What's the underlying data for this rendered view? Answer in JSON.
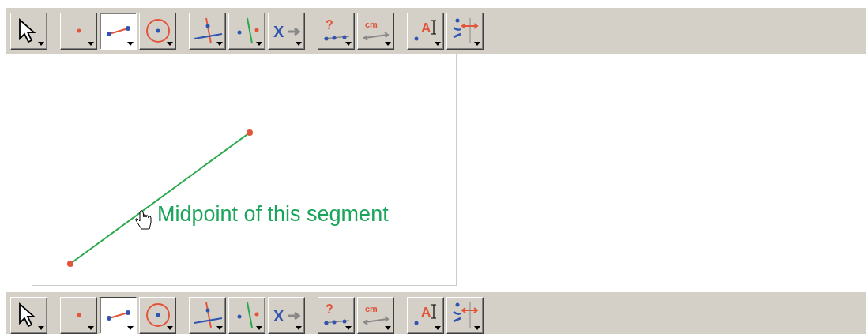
{
  "toolbars": [
    {
      "groups": [
        [
          {
            "kind": "select",
            "selected": false
          }
        ],
        [
          {
            "kind": "point",
            "selected": false
          },
          {
            "kind": "segment",
            "selected": true
          },
          {
            "kind": "circle",
            "selected": false
          }
        ],
        [
          {
            "kind": "perpendicular",
            "selected": false
          },
          {
            "kind": "parallel",
            "selected": false
          },
          {
            "kind": "transform",
            "selected": false,
            "glyph": "X"
          }
        ],
        [
          {
            "kind": "measure",
            "selected": false,
            "glyph": "?"
          },
          {
            "kind": "length",
            "selected": false,
            "glyph": "cm"
          }
        ],
        [
          {
            "kind": "label",
            "selected": false,
            "glyph": "A"
          },
          {
            "kind": "info",
            "selected": false
          }
        ]
      ]
    },
    {
      "groups": [
        [
          {
            "kind": "select",
            "selected": false
          }
        ],
        [
          {
            "kind": "point",
            "selected": false
          },
          {
            "kind": "segment",
            "selected": true
          },
          {
            "kind": "circle",
            "selected": false
          }
        ],
        [
          {
            "kind": "perpendicular",
            "selected": false
          },
          {
            "kind": "parallel",
            "selected": false
          },
          {
            "kind": "transform",
            "selected": false,
            "glyph": "X"
          }
        ],
        [
          {
            "kind": "measure",
            "selected": false,
            "glyph": "?"
          },
          {
            "kind": "length",
            "selected": false,
            "glyph": "cm"
          }
        ],
        [
          {
            "kind": "label",
            "selected": false,
            "glyph": "A"
          },
          {
            "kind": "info",
            "selected": false
          }
        ]
      ]
    }
  ],
  "canvas": {
    "hint": "Midpoint of this segment"
  }
}
